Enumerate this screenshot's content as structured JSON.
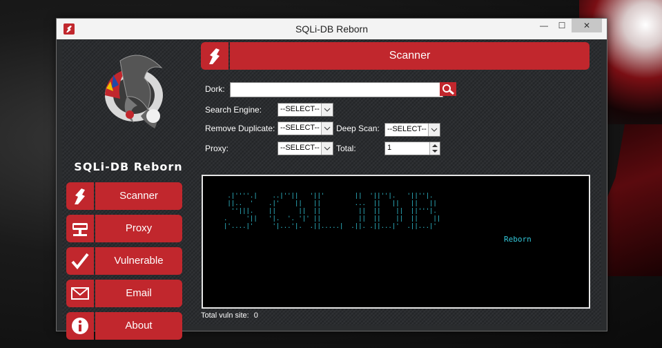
{
  "window": {
    "title": "SQLi-DB Reborn",
    "min_glyph": "—",
    "max_glyph": "☐",
    "close_glyph": "✕"
  },
  "brand": "SQLi-DB Reborn",
  "nav": [
    {
      "label": "Scanner",
      "icon": "scanner-icon"
    },
    {
      "label": "Proxy",
      "icon": "proxy-icon"
    },
    {
      "label": "Vulnerable",
      "icon": "checkmark-icon"
    },
    {
      "label": "Email",
      "icon": "envelope-icon"
    },
    {
      "label": "About",
      "icon": "info-icon"
    }
  ],
  "header": {
    "label": "Scanner",
    "icon": "scanner-icon"
  },
  "form": {
    "dork_label": "Dork:",
    "dork_value": "",
    "search_engine_label": "Search Engine:",
    "search_engine_value": "--SELECT--",
    "remove_duplicate_label": "Remove Duplicate:",
    "remove_duplicate_value": "--SELECT--",
    "deep_scan_label": "Deep Scan:",
    "deep_scan_value": "--SELECT--",
    "proxy_label": "Proxy:",
    "proxy_value": "--SELECT--",
    "total_label": "Total:",
    "total_value": "1"
  },
  "terminal": {
    "ascii_art": " .|''''.|    ..|''||   '||'        ||  '||''|.   '||''|.\n ||..  '    .|'    ||   ||         ...  ||   ||   ||   ||\n  ''|||.    ||      ||  ||          ||  ||    ||  ||'''|.\n.     '||   '|.  '. '|' ||          ||  ||    ||  ||    ||\n|'....|'     '|...'|.  .||.....|  .||. .||...|'  .||...|'",
    "suffix": "Reborn"
  },
  "status": {
    "total_vuln_label": "Total vuln site:",
    "total_vuln_value": "0"
  },
  "colors": {
    "accent": "#c1272d",
    "terminal_text": "#33c7d9",
    "panel_bg": "#2b2d30"
  }
}
